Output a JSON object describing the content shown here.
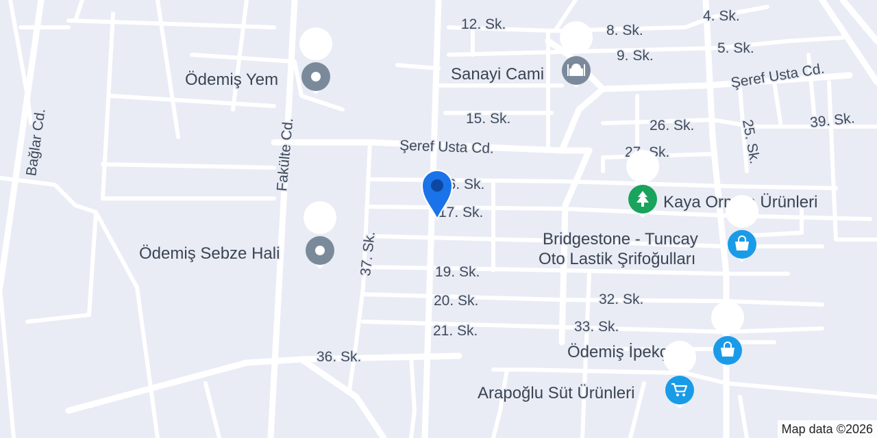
{
  "map": {
    "streets": {
      "s12": "12. Sk.",
      "s8": "8. Sk.",
      "s4": "4. Sk.",
      "s9": "9. Sk.",
      "s5": "5. Sk.",
      "seref_usta_ne": "Şeref Usta Cd.",
      "seref_usta": "Şeref Usta Cd.",
      "s15": "15. Sk.",
      "s26": "26. Sk.",
      "s39": "39. Sk.",
      "s25": "25. Sk.",
      "s27": "27. Sk.",
      "s16": "16. Sk.",
      "s17": "17. Sk.",
      "s19": "19. Sk.",
      "s20": "20. Sk.",
      "s32": "32. Sk.",
      "s33": "33. Sk.",
      "s21": "21. Sk.",
      "s36": "36. Sk.",
      "s37": "37. Sk.",
      "fakulte": "Fakülte Cd.",
      "baglar": "Bağlar Cd."
    },
    "pois": {
      "sanayi_cami": {
        "label": "Sanayi Cami",
        "icon": "mosque-icon",
        "color": "#7b8a9b"
      },
      "odemis_yem": {
        "label": "Ödemiş Yem",
        "icon": "place-icon",
        "color": "#7b8a9b"
      },
      "kaya_orman": {
        "label": "Kaya Orman Ürünleri",
        "icon": "tree-icon",
        "color": "#1aa35c"
      },
      "bridgestone": {
        "label_line1": "Bridgestone - Tuncay",
        "label_line2": "Oto Lastik Şrifoğulları",
        "icon": "shopping-bag-icon",
        "color": "#1a9be8"
      },
      "sebze_hali": {
        "label": "Ödemiş Sebze Hali",
        "icon": "place-icon",
        "color": "#7b8a9b"
      },
      "ipekcilik": {
        "label": "Ödemiş İpekçilik",
        "icon": "shopping-bag-icon",
        "color": "#1a9be8"
      },
      "arapoglu": {
        "label": "Arapoğlu Süt Ürünleri",
        "icon": "cart-icon",
        "color": "#1a9be8"
      }
    },
    "marker": {
      "icon": "location-pin-icon",
      "color": "#1a73e8"
    },
    "attribution": "Map data ©2026"
  }
}
